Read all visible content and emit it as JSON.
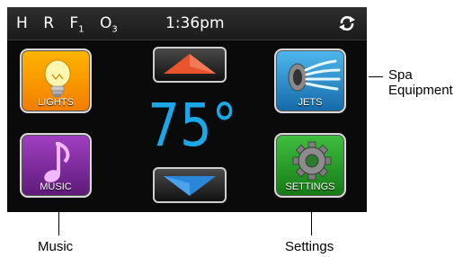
{
  "status_bar": {
    "indicators": [
      {
        "main": "H",
        "sub": ""
      },
      {
        "main": "R",
        "sub": ""
      },
      {
        "main": "F",
        "sub": "1"
      },
      {
        "main": "O",
        "sub": "3"
      }
    ],
    "time": "1:36pm",
    "sync_icon": "sync-icon"
  },
  "temperature": "75°",
  "tiles": {
    "lights": {
      "label": "LIGHTS",
      "icon": "lightbulb-icon",
      "color": "#f7a000"
    },
    "music": {
      "label": "MUSIC",
      "icon": "music-note-icon",
      "color": "#8a2fab"
    },
    "jets": {
      "label": "JETS",
      "icon": "jets-icon",
      "color": "#2a8fd0"
    },
    "settings": {
      "label": "SETTINGS",
      "icon": "gear-icon",
      "color": "#2fa82f"
    }
  },
  "controls": {
    "up_icon": "up-arrow-icon",
    "down_icon": "down-arrow-icon"
  },
  "callouts": {
    "spa_equipment_line1": "Spa",
    "spa_equipment_line2": "Equipment",
    "music": "Music",
    "settings": "Settings"
  },
  "colors": {
    "temperature": "#1ba8e8",
    "up_arrow": "#e8542e",
    "down_arrow": "#2a86d8"
  }
}
